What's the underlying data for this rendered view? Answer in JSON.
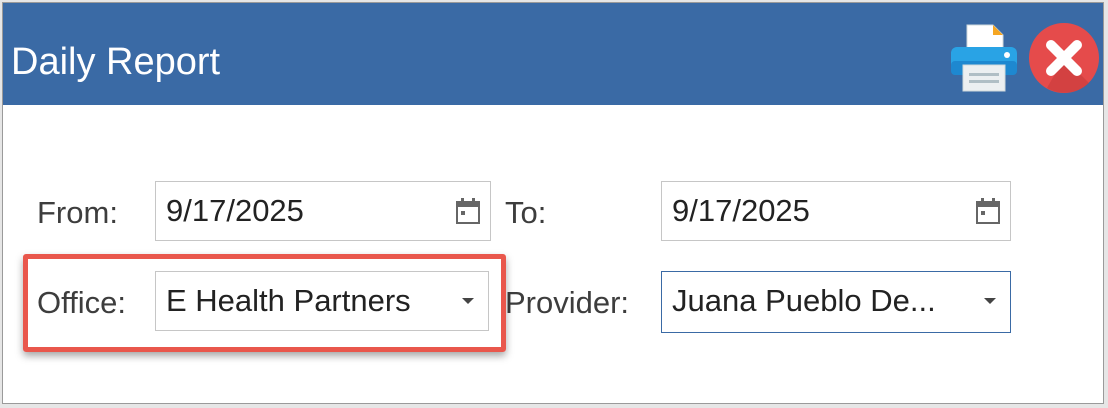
{
  "window": {
    "title": "Daily Report"
  },
  "toolbar": {
    "print_icon": "printer-icon",
    "close_icon": "close-icon"
  },
  "form": {
    "from_label": "From:",
    "from_value": "9/17/2025",
    "to_label": "To:",
    "to_value": "9/17/2025",
    "office_label": "Office:",
    "office_value": "E Health Partners",
    "provider_label": "Provider:",
    "provider_value": "Juana Pueblo De..."
  },
  "colors": {
    "titlebar": "#3a6aa5",
    "highlight": "#e9574c",
    "close": "#e54b4b"
  }
}
